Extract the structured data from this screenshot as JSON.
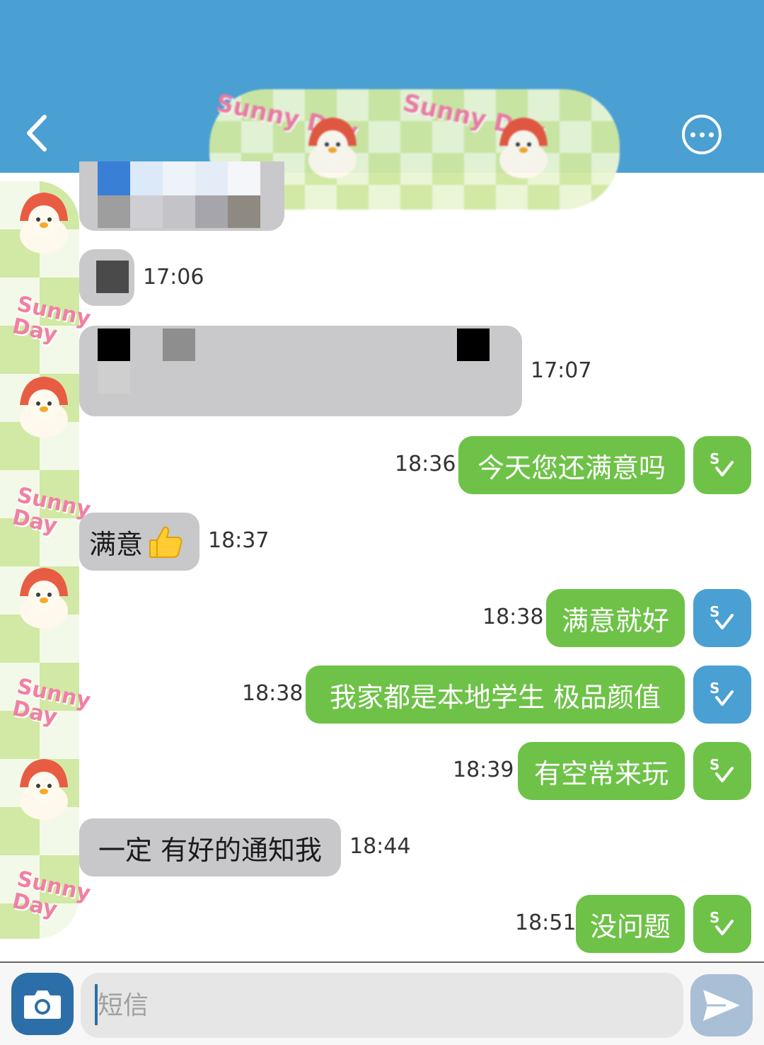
{
  "header": {
    "back_icon": "chevron-left-icon",
    "more_icon": "ellipsis-circle-icon",
    "background_color": "#4a9fd3",
    "sticker_text": "Sunny Day"
  },
  "messages": [
    {
      "direction": "incoming",
      "type": "image",
      "time": ""
    },
    {
      "direction": "incoming",
      "type": "image",
      "time": "17:06"
    },
    {
      "direction": "incoming",
      "type": "image",
      "time": "17:07"
    },
    {
      "direction": "outgoing",
      "text": "今天您还满意吗",
      "time": "18:36",
      "status_color": "green"
    },
    {
      "direction": "incoming",
      "text": "满意",
      "emoji": "thumbs-up",
      "time": "18:37"
    },
    {
      "direction": "outgoing",
      "text": "满意就好",
      "time": "18:38",
      "status_color": "blue"
    },
    {
      "direction": "outgoing",
      "text": "我家都是本地学生 极品颜值",
      "time": "18:38",
      "status_color": "blue"
    },
    {
      "direction": "outgoing",
      "text": "有空常来玩",
      "time": "18:39",
      "status_color": "green"
    },
    {
      "direction": "incoming",
      "text": "一定 有好的通知我",
      "time": "18:44"
    },
    {
      "direction": "outgoing",
      "text": "没问题",
      "time": "18:51",
      "status_color": "green"
    }
  ],
  "colors": {
    "outgoing_bubble": "#6ec247",
    "incoming_bubble": "#c8c8ca",
    "status_blue": "#4a9fd3",
    "status_green": "#6ec247"
  },
  "composer": {
    "placeholder": "短信",
    "camera_icon": "camera-icon",
    "send_icon": "send-icon"
  }
}
